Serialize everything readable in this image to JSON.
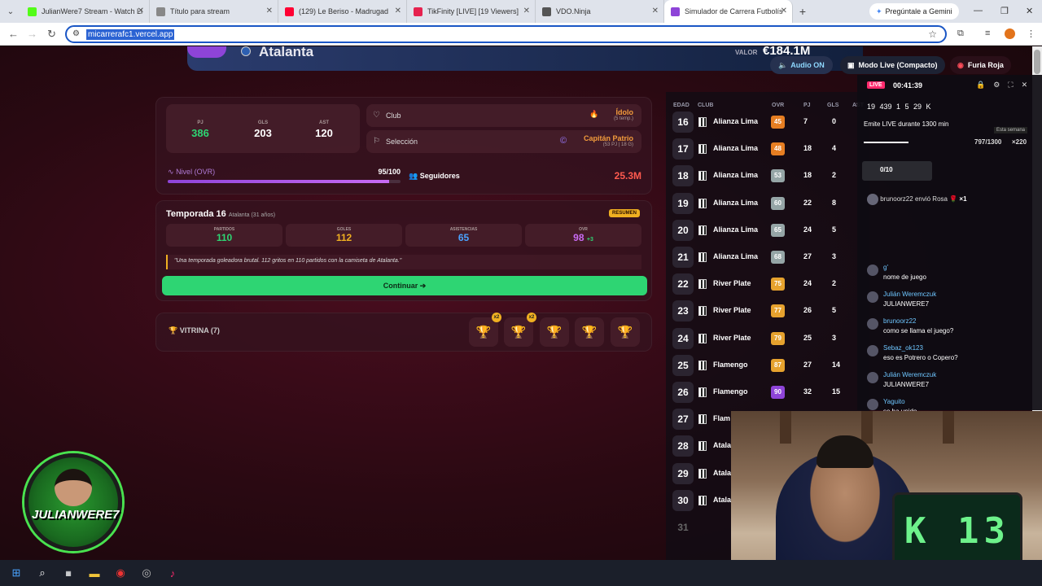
{
  "browser": {
    "tabs": [
      {
        "title": "JulianWere7 Stream - Watch Li",
        "color": "#53fc18"
      },
      {
        "title": "Título para stream",
        "color": "#888888"
      },
      {
        "title": "(129) Le Beriso - Madrugad",
        "color": "#ff0033"
      },
      {
        "title": "TikFinity [LIVE] [19 Viewers]",
        "color": "#e6224f"
      },
      {
        "title": "VDO.Ninja",
        "color": "#555555"
      },
      {
        "title": "Simulador de Carrera Futbolís",
        "color": "#8e44d8"
      }
    ],
    "gemini": "Pregúntale a Gemini",
    "url": "micarrerafc1.vercel.app"
  },
  "header": {
    "team": "Atalanta",
    "valor_label": "VALOR",
    "valor": "€184.1M",
    "audio": "Audio ON",
    "modo": "Modo Live (Compacto)",
    "furia": "Furia Roja"
  },
  "stats": {
    "pj_label": "PJ",
    "pj": "386",
    "gls_label": "GLS",
    "gls": "203",
    "ast_label": "AST",
    "ast": "120",
    "club_label": "Club",
    "club_value": "Ídolo",
    "club_sub": "(5 temp.)",
    "sel_label": "Selección",
    "sel_value": "Capitán Patrio",
    "sel_sub": "(53 PJ | 18 G)",
    "nivel_label": "Nivel (OVR)",
    "nivel_value": "95/100",
    "nivel_fraction": 0.95,
    "seg_label": "Seguidores",
    "seg_value": "25.3M"
  },
  "temporada": {
    "title": "Temporada 16",
    "sub": "Atalanta (31 años)",
    "resumen": "RESUMEN",
    "partidos_label": "PARTIDOS",
    "partidos": "110",
    "goles_label": "GOLES",
    "goles": "112",
    "asist_label": "ASISTENCIAS",
    "asist": "65",
    "ovr_label": "OVR",
    "ovr": "98",
    "ovr_delta": "+3",
    "quote": "\"Una temporada goleadora brutal. 112 gritos en 110 partidos con la camiseta de Atalanta.\"",
    "continuar": "Continuar ➔"
  },
  "vitrina": {
    "label": "VITRINA (7)",
    "badges": [
      "x2",
      "x2"
    ]
  },
  "career": {
    "headers": [
      "EDAD",
      "CLUB",
      "OVR",
      "PJ",
      "GLS",
      "AST"
    ],
    "rows": [
      {
        "age": "16",
        "club": "Alianza Lima",
        "ovr": "45",
        "ovrc": "#e67e22",
        "pj": "7",
        "gls": "0"
      },
      {
        "age": "17",
        "club": "Alianza Lima",
        "ovr": "48",
        "ovrc": "#e67e22",
        "pj": "18",
        "gls": "4"
      },
      {
        "age": "18",
        "club": "Alianza Lima",
        "ovr": "53",
        "ovrc": "#95a5a6",
        "pj": "18",
        "gls": "2"
      },
      {
        "age": "19",
        "club": "Alianza Lima",
        "ovr": "60",
        "ovrc": "#95a5a6",
        "pj": "22",
        "gls": "8"
      },
      {
        "age": "20",
        "club": "Alianza Lima",
        "ovr": "65",
        "ovrc": "#95a5a6",
        "pj": "24",
        "gls": "5"
      },
      {
        "age": "21",
        "club": "Alianza Lima",
        "ovr": "68",
        "ovrc": "#95a5a6",
        "pj": "27",
        "gls": "3"
      },
      {
        "age": "22",
        "club": "River Plate",
        "ovr": "75",
        "ovrc": "#e6a22e",
        "pj": "24",
        "gls": "2"
      },
      {
        "age": "23",
        "club": "River Plate",
        "ovr": "77",
        "ovrc": "#e6a22e",
        "pj": "26",
        "gls": "5"
      },
      {
        "age": "24",
        "club": "River Plate",
        "ovr": "79",
        "ovrc": "#e6a22e",
        "pj": "25",
        "gls": "3"
      },
      {
        "age": "25",
        "club": "Flamengo",
        "ovr": "87",
        "ovrc": "#e6a22e",
        "pj": "27",
        "gls": "14"
      },
      {
        "age": "26",
        "club": "Flamengo",
        "ovr": "90",
        "ovrc": "#8e44d8",
        "pj": "32",
        "gls": "15"
      },
      {
        "age": "27",
        "club": "Flam",
        "ovr": "",
        "ovrc": "",
        "pj": "",
        "gls": ""
      },
      {
        "age": "28",
        "club": "Atala",
        "ovr": "",
        "ovrc": "",
        "pj": "",
        "gls": ""
      },
      {
        "age": "29",
        "club": "Atala",
        "ovr": "",
        "ovrc": "",
        "pj": "",
        "gls": ""
      },
      {
        "age": "30",
        "club": "Atala",
        "ovr": "",
        "ovrc": "",
        "pj": "",
        "gls": ""
      },
      {
        "age": "31",
        "club": "",
        "ovr": "",
        "ovrc": "",
        "pj": "",
        "gls": ""
      }
    ]
  },
  "live": {
    "badge": "LIVE",
    "timer": "00:41:39",
    "stats": "19  439  1  5  29 K",
    "goal": "Emite LIVE durante 1300 min",
    "semana": "Esta semana",
    "goal_value": "797/1300",
    "goal_fraction": 0.613,
    "x220": "×220",
    "ten": "0/10",
    "gift_user": "brunoorz22",
    "gift_text": "envió Rosa",
    "gift_count": "×1",
    "chat": [
      {
        "user": "g'",
        "msg": "nome de juego"
      },
      {
        "user": "Julián Weremczuk",
        "msg": "JULIANWERE7"
      },
      {
        "user": "brunoorz22",
        "msg": "como se llama el juego?"
      },
      {
        "user": "Sebaz_ok123",
        "msg": "eso es Potrero o Copero?"
      },
      {
        "user": "Julián Weremczuk",
        "msg": "JULIANWERE7"
      },
      {
        "user": "Yaguito",
        "msg": "se ha unido"
      }
    ]
  },
  "avatar": {
    "name": "JULIANWERE7"
  },
  "cam": {
    "display": "K 13"
  }
}
